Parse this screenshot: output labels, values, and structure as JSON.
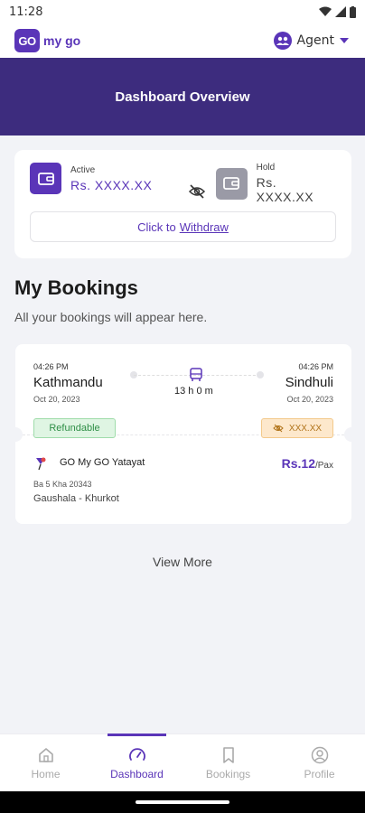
{
  "status": {
    "time": "11:28"
  },
  "app": {
    "logo_text": "GO",
    "brand": "my go",
    "role": "Agent"
  },
  "banner": {
    "title": "Dashboard Overview"
  },
  "wallet": {
    "active_label": "Active",
    "active_value": "Rs. XXXX.XX",
    "hold_label": "Hold",
    "hold_value": "Rs. XXXX.XX",
    "withdraw_prefix": "Click to",
    "withdraw_link": "Withdraw",
    "colors": {
      "active_icon_bg": "#5a35b8",
      "hold_icon_bg": "#9a9aa6"
    }
  },
  "bookings": {
    "title": "My Bookings",
    "subtitle": "All your bookings will appear here.",
    "card": {
      "depart_time": "04:26 PM",
      "depart_city": "Kathmandu",
      "depart_date": "Oct 20, 2023",
      "arrive_time": "04:26 PM",
      "arrive_city": "Sindhuli",
      "arrive_date": "Oct 20, 2023",
      "duration": "13 h 0 m",
      "refund_badge": "Refundable",
      "price_badge": "XXX.XX",
      "operator": "GO My GO Yatayat",
      "vehicle": "Ba 5 Kha 20343",
      "route": "Gaushala - Khurkot",
      "fare": "Rs.12",
      "fare_unit": "/Pax"
    },
    "view_more": "View More"
  },
  "nav": {
    "items": [
      {
        "label": "Home",
        "icon": "home-icon"
      },
      {
        "label": "Dashboard",
        "icon": "speedometer-icon"
      },
      {
        "label": "Bookings",
        "icon": "bookmark-icon"
      },
      {
        "label": "Profile",
        "icon": "profile-icon"
      }
    ],
    "active": "Dashboard"
  }
}
